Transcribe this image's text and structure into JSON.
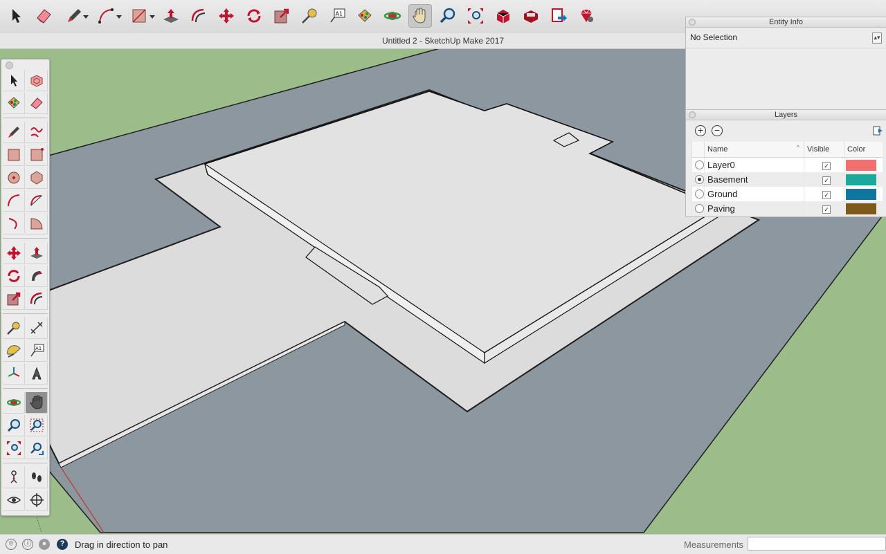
{
  "window": {
    "title": "Untitled 2 - SketchUp Make 2017"
  },
  "toolbar": {
    "tools": [
      "select-tool",
      "eraser-tool",
      "line-tool",
      "arc-tool",
      "rectangle-tool",
      "push-pull-tool",
      "offset-tool",
      "move-tool",
      "rotate-tool",
      "scale-tool",
      "tape-measure-tool",
      "text-tool",
      "paint-bucket-tool",
      "orbit-tool",
      "pan-tool",
      "zoom-tool",
      "zoom-extents-tool",
      "warehouse-tool",
      "extension-warehouse-tool",
      "send-to-layout-tool",
      "extension-manager-tool"
    ],
    "active": "pan-tool"
  },
  "palette": {
    "active": "pan-tool",
    "text_tool_label": "A1"
  },
  "entity_info": {
    "title": "Entity Info",
    "selection": "No Selection"
  },
  "layers": {
    "title": "Layers",
    "columns": {
      "name": "Name",
      "visible": "Visible",
      "color": "Color"
    },
    "rows": [
      {
        "name": "Layer0",
        "active": false,
        "visible": true,
        "color": "#f36e6e"
      },
      {
        "name": "Basement",
        "active": true,
        "visible": true,
        "color": "#1ca89a"
      },
      {
        "name": "Ground",
        "active": false,
        "visible": true,
        "color": "#0e76a0"
      },
      {
        "name": "Paving",
        "active": false,
        "visible": true,
        "color": "#7d5a1c"
      }
    ]
  },
  "status": {
    "message": "Drag in direction to pan",
    "measurements_label": "Measurements",
    "measurements_value": ""
  },
  "scene": {
    "ground_color": "#9bbd8a",
    "basement_color": "#8c979f",
    "paving_color": "#dcdcdc",
    "slab_color": "#e0e0e0"
  }
}
